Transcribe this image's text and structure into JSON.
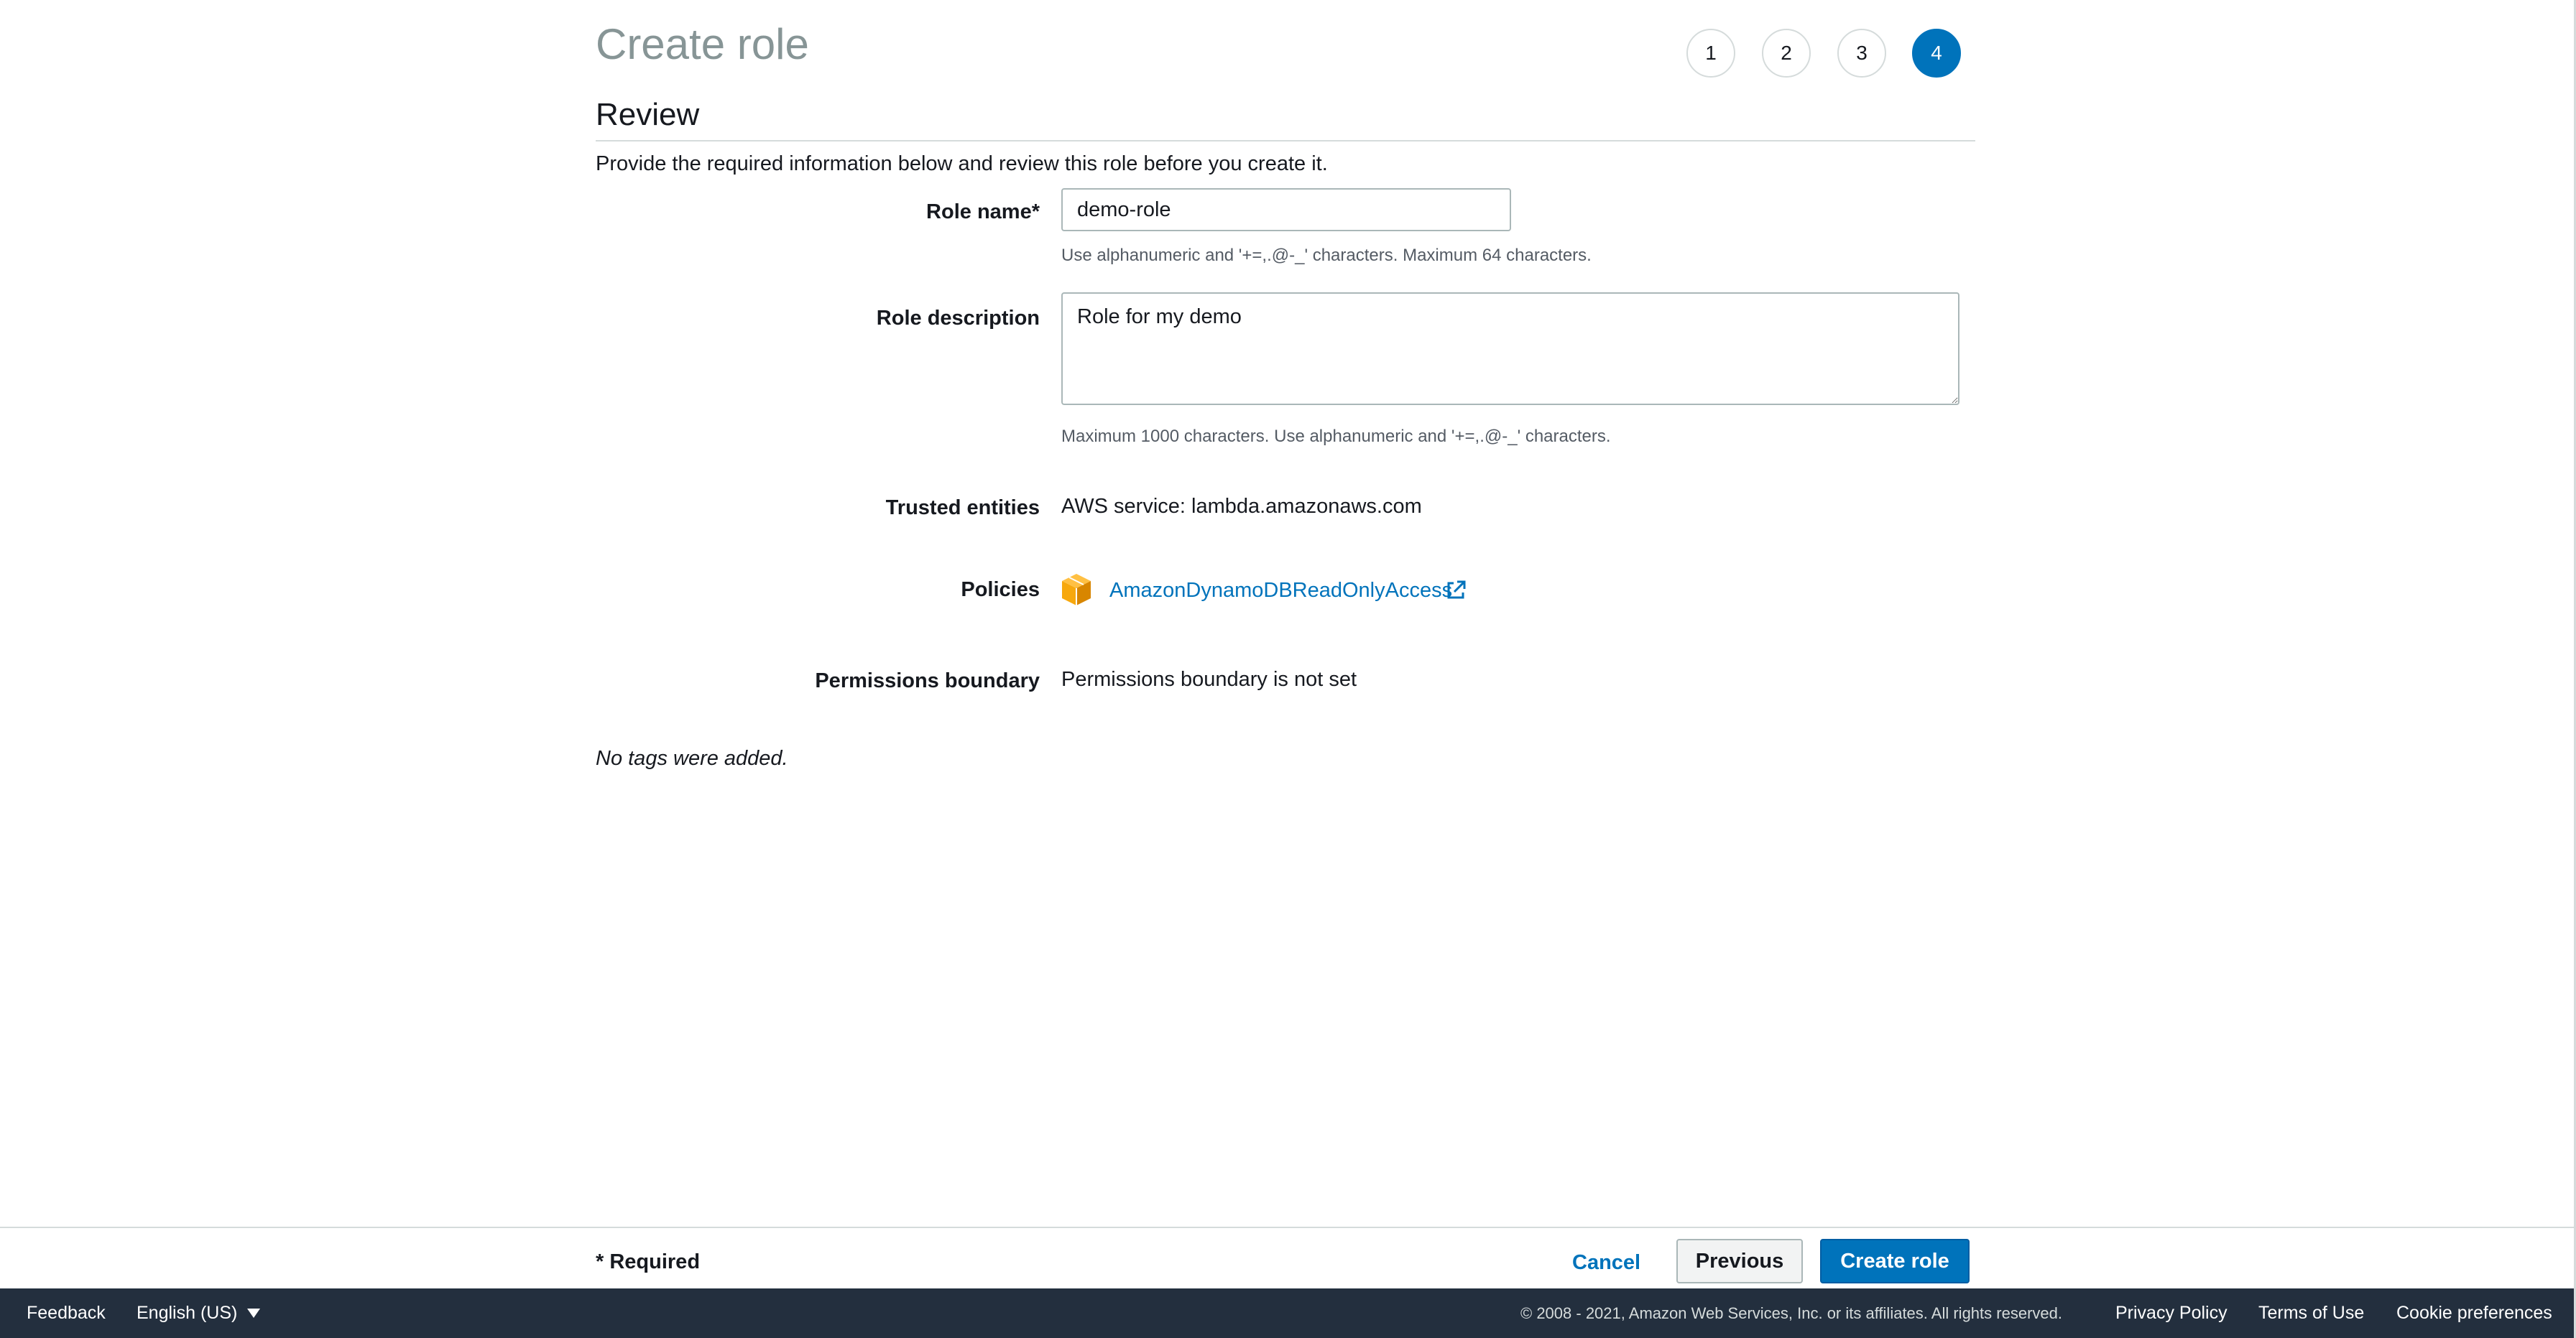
{
  "header": {
    "title": "Create role",
    "steps": [
      "1",
      "2",
      "3",
      "4"
    ],
    "active_step": 4
  },
  "review": {
    "section_title": "Review",
    "intro": "Provide the required information below and review this role before you create it.",
    "role_name": {
      "label": "Role name*",
      "value": "demo-role",
      "hint": "Use alphanumeric and '+=,.@-_' characters. Maximum 64 characters."
    },
    "role_description": {
      "label": "Role description",
      "value": "Role for my demo",
      "hint": "Maximum 1000 characters. Use alphanumeric and '+=,.@-_' characters."
    },
    "trusted_entities": {
      "label": "Trusted entities",
      "value": "AWS service: lambda.amazonaws.com"
    },
    "policies": {
      "label": "Policies",
      "items": [
        {
          "name": "AmazonDynamoDBReadOnlyAccess",
          "icon": "aws-managed-policy-cube-icon"
        }
      ]
    },
    "permissions_boundary": {
      "label": "Permissions boundary",
      "value": "Permissions boundary is not set"
    },
    "tags_note": "No tags were added."
  },
  "actions": {
    "required_note": "* Required",
    "cancel": "Cancel",
    "previous": "Previous",
    "create": "Create role"
  },
  "console_footer": {
    "feedback": "Feedback",
    "language": "English (US)",
    "copyright": "© 2008 - 2021, Amazon Web Services, Inc. or its affiliates. All rights reserved.",
    "privacy": "Privacy Policy",
    "terms": "Terms of Use",
    "cookies": "Cookie preferences"
  },
  "colors": {
    "accent": "#0073bb",
    "policy_icon": "#f7a80d",
    "footer_bg": "#232f3e"
  }
}
